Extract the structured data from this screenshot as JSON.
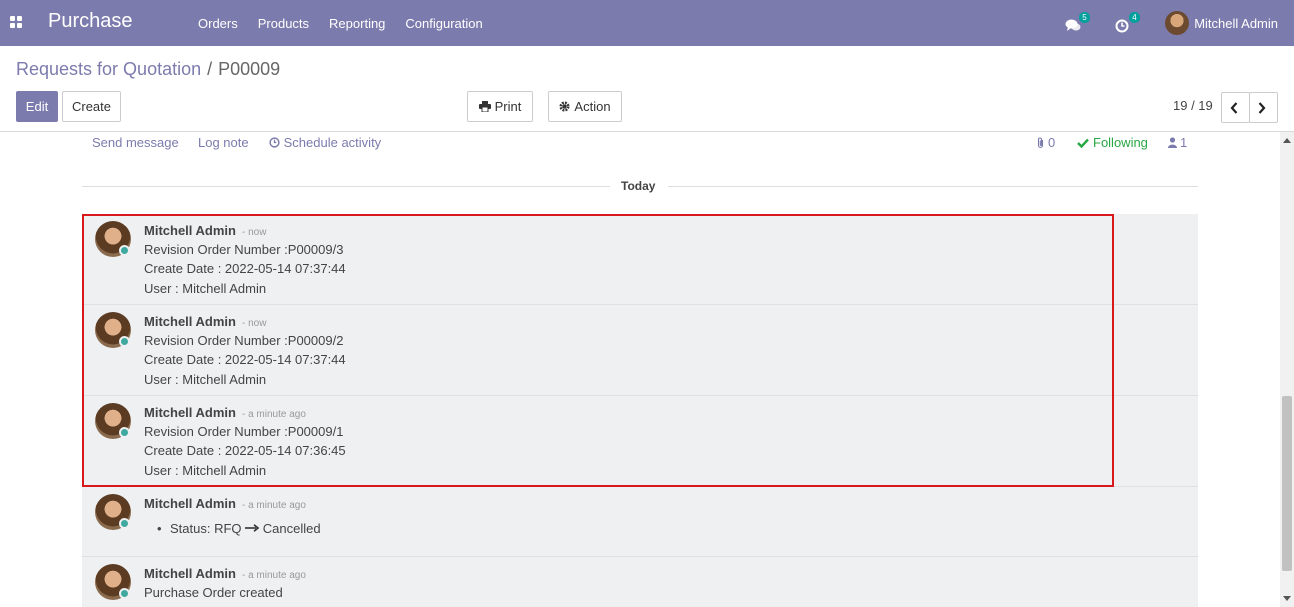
{
  "navbar": {
    "app_name": "Purchase",
    "menu": [
      "Orders",
      "Products",
      "Reporting",
      "Configuration"
    ],
    "messages_badge": "5",
    "activities_badge": "4",
    "user_name": "Mitchell Admin"
  },
  "control_panel": {
    "breadcrumb_parent": "Requests for Quotation",
    "breadcrumb_sep": "/",
    "breadcrumb_current": "P00009",
    "edit_label": "Edit",
    "create_label": "Create",
    "print_label": "Print",
    "action_label": "Action",
    "pager": "19 / 19"
  },
  "chatter": {
    "send_message": "Send message",
    "log_note": "Log note",
    "schedule_activity": "Schedule activity",
    "attachments_count": "0",
    "following_label": "Following",
    "followers_count": "1",
    "day_label": "Today"
  },
  "messages": [
    {
      "author": "Mitchell Admin",
      "date": "- now",
      "lines": [
        "Revision Order Number :P00009/3",
        "Create Date : 2022-05-14 07:37:44",
        "User : Mitchell Admin"
      ]
    },
    {
      "author": "Mitchell Admin",
      "date": "- now",
      "lines": [
        "Revision Order Number :P00009/2",
        "Create Date : 2022-05-14 07:37:44",
        "User : Mitchell Admin"
      ]
    },
    {
      "author": "Mitchell Admin",
      "date": "- a minute ago",
      "lines": [
        "Revision Order Number :P00009/1",
        "Create Date : 2022-05-14 07:36:45",
        "User : Mitchell Admin"
      ]
    },
    {
      "author": "Mitchell Admin",
      "date": "- a minute ago",
      "status_prefix": "Status: RFQ",
      "status_value": "Cancelled"
    },
    {
      "author": "Mitchell Admin",
      "date": "- a minute ago",
      "lines": [
        "Purchase Order created"
      ]
    }
  ],
  "colors": {
    "brand": "#7c7bad",
    "following": "#28a745",
    "highlight": "#d7191c",
    "online": "#3fa9a0"
  }
}
